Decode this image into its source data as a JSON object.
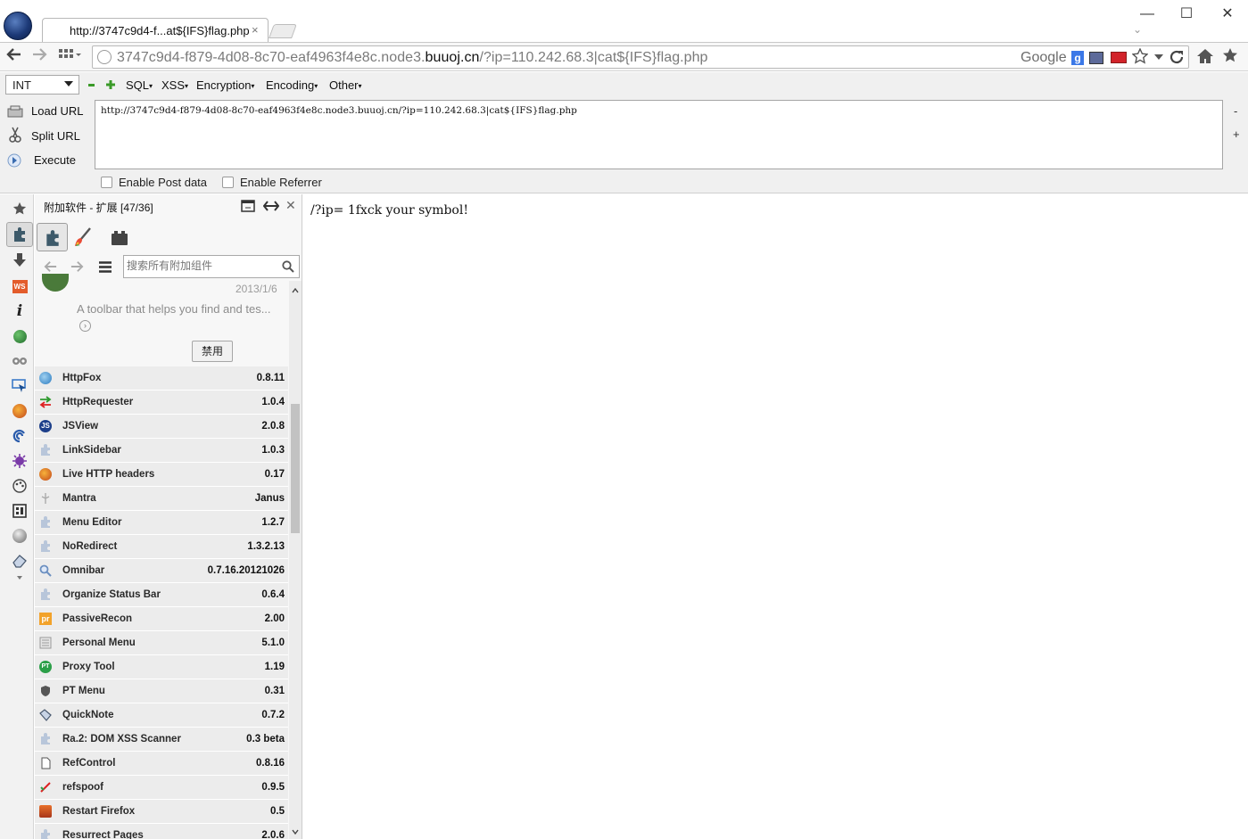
{
  "window": {
    "tab_title": "http://3747c9d4-f...at${IFS}flag.php",
    "tab_close": "×",
    "minimize": "—",
    "maximize": "☐",
    "close": "✕",
    "tab_list_caret": "⌄"
  },
  "navbar": {
    "url_prefix": "3747c9d4-f879-4d08-8c70-eaf4963f4e8c.node3.",
    "url_domain": "buuoj.cn",
    "url_suffix": "/?ip=110.242.68.3|cat${IFS}flag.php",
    "search_engine": "Google"
  },
  "hackbar": {
    "encoding_select": "INT",
    "menus": [
      "SQL",
      "XSS",
      "Encryption",
      "Encoding",
      "Other"
    ],
    "load_url": "Load URL",
    "split_url": "Split URL",
    "execute": "Execute",
    "url_value": "http://3747c9d4-f879-4d08-8c70-eaf4963f4e8c.node3.buuoj.cn/?ip=110.242.68.3|cat${IFS}flag.php",
    "minus": "-",
    "plus": "+",
    "enable_post": "Enable Post data",
    "enable_referrer": "Enable Referrer"
  },
  "sidebar": {
    "header": "附加软件 - 扩展 [47/36]",
    "search_placeholder": "搜索所有附加组件",
    "partial_date": "2013/1/6",
    "partial_desc": "A toolbar that helps you find and tes...",
    "disable_button": "禁用",
    "extensions": [
      {
        "name": "HttpFox",
        "version": "0.8.11"
      },
      {
        "name": "HttpRequester",
        "version": "1.0.4"
      },
      {
        "name": "JSView",
        "version": "2.0.8"
      },
      {
        "name": "LinkSidebar",
        "version": "1.0.3"
      },
      {
        "name": "Live HTTP headers",
        "version": "0.17"
      },
      {
        "name": "Mantra",
        "version": "Janus"
      },
      {
        "name": "Menu Editor",
        "version": "1.2.7"
      },
      {
        "name": "NoRedirect",
        "version": "1.3.2.13"
      },
      {
        "name": "Omnibar",
        "version": "0.7.16.20121026"
      },
      {
        "name": "Organize Status Bar",
        "version": "0.6.4"
      },
      {
        "name": "PassiveRecon",
        "version": "2.00"
      },
      {
        "name": "Personal Menu",
        "version": "5.1.0"
      },
      {
        "name": "Proxy Tool",
        "version": "1.19"
      },
      {
        "name": "PT Menu",
        "version": "0.31"
      },
      {
        "name": "QuickNote",
        "version": "0.7.2"
      },
      {
        "name": "Ra.2: DOM XSS Scanner",
        "version": "0.3 beta"
      },
      {
        "name": "RefControl",
        "version": "0.8.16"
      },
      {
        "name": "refspoof",
        "version": "0.9.5"
      },
      {
        "name": "Restart Firefox",
        "version": "0.5"
      },
      {
        "name": "Resurrect Pages",
        "version": "2.0.6"
      }
    ]
  },
  "content": {
    "text": "/?ip= 1fxck your symbol!"
  },
  "colors": {
    "row_bg": "#ececec",
    "toolbar_bg": "#f0f0f0",
    "flag_red": "#d2232a"
  }
}
